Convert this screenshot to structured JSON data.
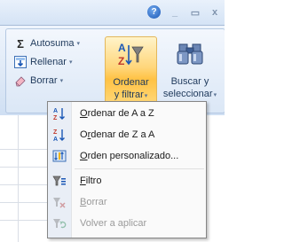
{
  "window_controls": {
    "help": "?",
    "minimize": "_",
    "maximize": "▭",
    "close": "x"
  },
  "ribbon": {
    "autosuma": "Autosuma",
    "rellenar": "Rellenar",
    "borrar": "Borrar",
    "ordenar_filtrar_line1": "Ordenar",
    "ordenar_filtrar_line2": "y filtrar",
    "buscar_line1": "Buscar y",
    "buscar_line2": "seleccionar",
    "dropdown_arrow": "▾",
    "icons": {
      "autosuma": "sigma-icon",
      "rellenar": "fill-down-icon",
      "borrar": "eraser-icon",
      "ordenar_filtrar": "sort-filter-icon",
      "buscar": "binoculars-icon"
    }
  },
  "menu": {
    "items": [
      {
        "label": "Ordenar de A a Z",
        "underline": "O",
        "rest": "rdenar de A a Z",
        "icon": "sort-a-z-icon",
        "enabled": true
      },
      {
        "label": "Ordenar de Z a A",
        "underline": "r",
        "pre": "O",
        "rest": "denar de Z a A",
        "icon": "sort-z-a-icon",
        "enabled": true
      },
      {
        "label": "Orden personalizado...",
        "underline": "O",
        "rest": "rden personalizado...",
        "icon": "custom-sort-icon",
        "enabled": true
      },
      {
        "label": "Filtro",
        "underline": "F",
        "rest": "iltro",
        "icon": "filter-icon",
        "enabled": true
      },
      {
        "label": "Borrar",
        "underline": "B",
        "rest": "orrar",
        "icon": "clear-filter-icon",
        "enabled": false
      },
      {
        "label": "Volver a aplicar",
        "underline": "",
        "rest": "Volver a aplicar",
        "icon": "reapply-filter-icon",
        "enabled": false
      }
    ]
  }
}
